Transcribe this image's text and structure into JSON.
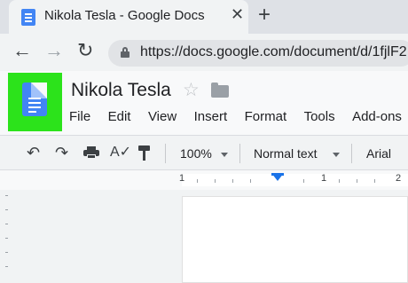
{
  "browser": {
    "tab_title": "Nikola Tesla - Google Docs",
    "tab_close": "✕",
    "new_tab": "+",
    "url": "https://docs.google.com/document/d/1fjlF2"
  },
  "nav": {
    "back": "←",
    "forward": "→",
    "reload": "↻"
  },
  "doc": {
    "title": "Nikola Tesla",
    "star": "☆",
    "menu": [
      "File",
      "Edit",
      "View",
      "Insert",
      "Format",
      "Tools",
      "Add-ons"
    ]
  },
  "toolbar": {
    "undo": "↶",
    "redo": "↷",
    "spellcheck": "A✓",
    "zoom": "100%",
    "style": "Normal text",
    "font": "Arial"
  },
  "ruler": {
    "labels": [
      "1",
      "1",
      "2"
    ]
  },
  "colors": {
    "highlight": "#2ce31b",
    "docs_blue": "#4285f4",
    "indent_blue": "#1a73e8"
  }
}
